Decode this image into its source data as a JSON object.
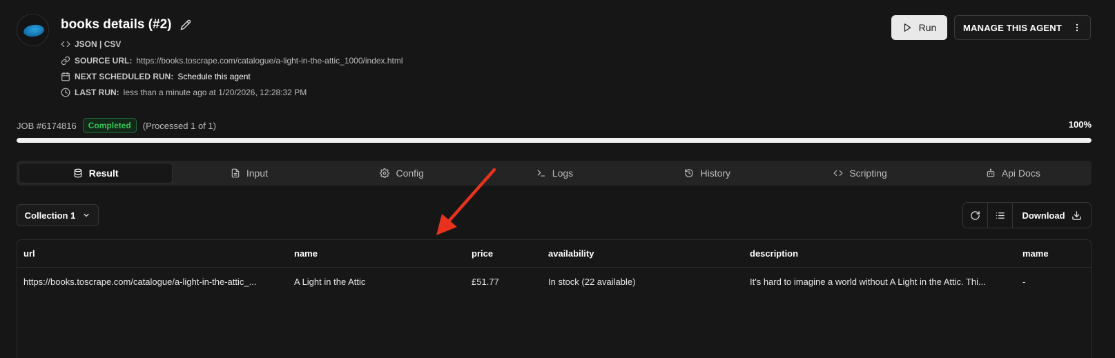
{
  "agent": {
    "title": "books details (#2)",
    "formats": "JSON | CSV",
    "source_url_label": "SOURCE URL:",
    "source_url": "https://books.toscrape.com/catalogue/a-light-in-the-attic_1000/index.html",
    "next_run_label": "NEXT SCHEDULED RUN:",
    "next_run_value": "Schedule this agent",
    "last_run_label": "LAST RUN:",
    "last_run_value": "less than a minute ago at 1/20/2026, 12:28:32 PM"
  },
  "actions": {
    "run_label": "Run",
    "manage_label": "MANAGE THIS AGENT"
  },
  "job": {
    "id_label": "JOB #6174816",
    "status": "Completed",
    "processed": "(Processed 1 of 1)",
    "percent_label": "100%",
    "progress": 1.0
  },
  "tabs": [
    {
      "label": "Result",
      "icon": "database-icon",
      "active": true
    },
    {
      "label": "Input",
      "icon": "file-text-icon"
    },
    {
      "label": "Config",
      "icon": "gear-icon"
    },
    {
      "label": "Logs",
      "icon": "terminal-icon"
    },
    {
      "label": "History",
      "icon": "history-icon"
    },
    {
      "label": "Scripting",
      "icon": "code-icon"
    },
    {
      "label": "Api Docs",
      "icon": "bot-icon"
    }
  ],
  "toolbar": {
    "collection_label": "Collection 1",
    "download_label": "Download"
  },
  "table": {
    "columns": [
      "url",
      "name",
      "price",
      "availability",
      "description",
      "mame"
    ],
    "rows": [
      [
        "https://books.toscrape.com/catalogue/a-light-in-the-attic_...",
        "A Light in the Attic",
        "£51.77",
        "In stock (22 available)",
        "It's hard to imagine a world without A Light in the Attic. Thi...",
        "-"
      ]
    ]
  },
  "colors": {
    "background": "#161616",
    "status_green": "#34c759",
    "annotation_arrow": "#e8321e"
  }
}
